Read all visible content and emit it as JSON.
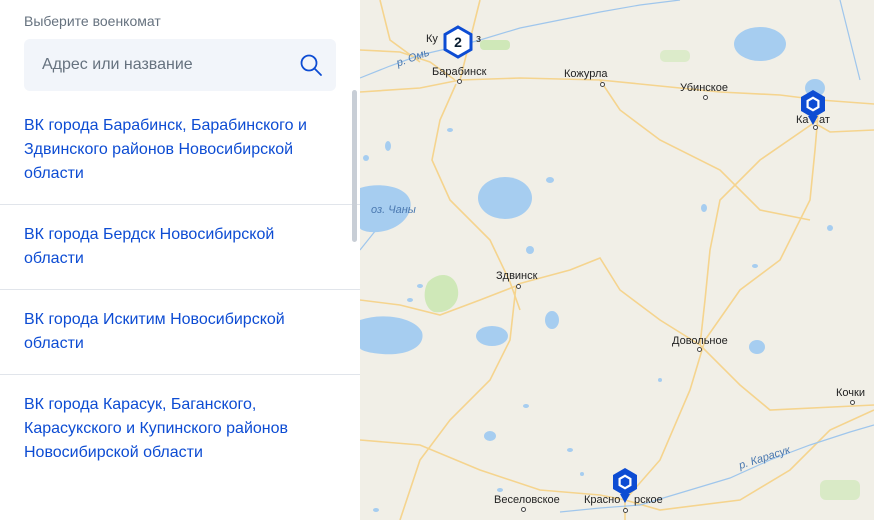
{
  "sidebar": {
    "title": "Выберите военкомат",
    "search": {
      "placeholder": "Адрес или название",
      "value": ""
    },
    "items": [
      {
        "label": "ВК города Барабинск, Барабинского и Здвинского районов Новосибирской области"
      },
      {
        "label": "ВК города Бердск Новосибирской области"
      },
      {
        "label": "ВК города Искитим Новосибирской области"
      },
      {
        "label": "ВК города Карасук, Баганского, Карасукского и Купинского районов Новосибирской области"
      }
    ]
  },
  "map": {
    "cluster": {
      "count": "2"
    },
    "towns": {
      "kuyb": "Ку",
      "kuyb_tail": "з",
      "barabinsk": "Барабинск",
      "kozhurla": "Кожурла",
      "ubinskoe": "Убинское",
      "kargat_a": "Ка",
      "kargat_b": "ат",
      "zdvinsk": "Здвинск",
      "dovolnoe": "Довольное",
      "kochki": "Кочки",
      "veselovskoe": "Веселовское",
      "krasnozerskoe_a": "Красно",
      "krasnozerskoe_b": "рское"
    },
    "labels": {
      "lake_chany": "оз. Чаны",
      "river_om": "р. Омь",
      "river_karasuk": "р. Карасук"
    },
    "colors": {
      "water": "#a6cdf0",
      "road": "#f5d48e",
      "marker": "#0d4cd3",
      "land": "#f1efe7"
    }
  }
}
